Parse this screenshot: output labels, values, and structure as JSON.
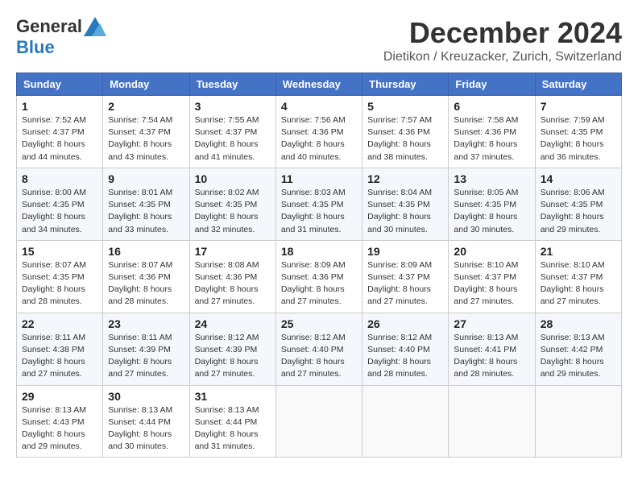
{
  "header": {
    "logo_general": "General",
    "logo_blue": "Blue",
    "month_title": "December 2024",
    "location": "Dietikon / Kreuzacker, Zurich, Switzerland"
  },
  "weekdays": [
    "Sunday",
    "Monday",
    "Tuesday",
    "Wednesday",
    "Thursday",
    "Friday",
    "Saturday"
  ],
  "weeks": [
    [
      {
        "day": "1",
        "sunrise": "7:52 AM",
        "sunset": "4:37 PM",
        "daylight": "8 hours and 44 minutes."
      },
      {
        "day": "2",
        "sunrise": "7:54 AM",
        "sunset": "4:37 PM",
        "daylight": "8 hours and 43 minutes."
      },
      {
        "day": "3",
        "sunrise": "7:55 AM",
        "sunset": "4:37 PM",
        "daylight": "8 hours and 41 minutes."
      },
      {
        "day": "4",
        "sunrise": "7:56 AM",
        "sunset": "4:36 PM",
        "daylight": "8 hours and 40 minutes."
      },
      {
        "day": "5",
        "sunrise": "7:57 AM",
        "sunset": "4:36 PM",
        "daylight": "8 hours and 38 minutes."
      },
      {
        "day": "6",
        "sunrise": "7:58 AM",
        "sunset": "4:36 PM",
        "daylight": "8 hours and 37 minutes."
      },
      {
        "day": "7",
        "sunrise": "7:59 AM",
        "sunset": "4:35 PM",
        "daylight": "8 hours and 36 minutes."
      }
    ],
    [
      {
        "day": "8",
        "sunrise": "8:00 AM",
        "sunset": "4:35 PM",
        "daylight": "8 hours and 34 minutes."
      },
      {
        "day": "9",
        "sunrise": "8:01 AM",
        "sunset": "4:35 PM",
        "daylight": "8 hours and 33 minutes."
      },
      {
        "day": "10",
        "sunrise": "8:02 AM",
        "sunset": "4:35 PM",
        "daylight": "8 hours and 32 minutes."
      },
      {
        "day": "11",
        "sunrise": "8:03 AM",
        "sunset": "4:35 PM",
        "daylight": "8 hours and 31 minutes."
      },
      {
        "day": "12",
        "sunrise": "8:04 AM",
        "sunset": "4:35 PM",
        "daylight": "8 hours and 30 minutes."
      },
      {
        "day": "13",
        "sunrise": "8:05 AM",
        "sunset": "4:35 PM",
        "daylight": "8 hours and 30 minutes."
      },
      {
        "day": "14",
        "sunrise": "8:06 AM",
        "sunset": "4:35 PM",
        "daylight": "8 hours and 29 minutes."
      }
    ],
    [
      {
        "day": "15",
        "sunrise": "8:07 AM",
        "sunset": "4:35 PM",
        "daylight": "8 hours and 28 minutes."
      },
      {
        "day": "16",
        "sunrise": "8:07 AM",
        "sunset": "4:36 PM",
        "daylight": "8 hours and 28 minutes."
      },
      {
        "day": "17",
        "sunrise": "8:08 AM",
        "sunset": "4:36 PM",
        "daylight": "8 hours and 27 minutes."
      },
      {
        "day": "18",
        "sunrise": "8:09 AM",
        "sunset": "4:36 PM",
        "daylight": "8 hours and 27 minutes."
      },
      {
        "day": "19",
        "sunrise": "8:09 AM",
        "sunset": "4:37 PM",
        "daylight": "8 hours and 27 minutes."
      },
      {
        "day": "20",
        "sunrise": "8:10 AM",
        "sunset": "4:37 PM",
        "daylight": "8 hours and 27 minutes."
      },
      {
        "day": "21",
        "sunrise": "8:10 AM",
        "sunset": "4:37 PM",
        "daylight": "8 hours and 27 minutes."
      }
    ],
    [
      {
        "day": "22",
        "sunrise": "8:11 AM",
        "sunset": "4:38 PM",
        "daylight": "8 hours and 27 minutes."
      },
      {
        "day": "23",
        "sunrise": "8:11 AM",
        "sunset": "4:39 PM",
        "daylight": "8 hours and 27 minutes."
      },
      {
        "day": "24",
        "sunrise": "8:12 AM",
        "sunset": "4:39 PM",
        "daylight": "8 hours and 27 minutes."
      },
      {
        "day": "25",
        "sunrise": "8:12 AM",
        "sunset": "4:40 PM",
        "daylight": "8 hours and 27 minutes."
      },
      {
        "day": "26",
        "sunrise": "8:12 AM",
        "sunset": "4:40 PM",
        "daylight": "8 hours and 28 minutes."
      },
      {
        "day": "27",
        "sunrise": "8:13 AM",
        "sunset": "4:41 PM",
        "daylight": "8 hours and 28 minutes."
      },
      {
        "day": "28",
        "sunrise": "8:13 AM",
        "sunset": "4:42 PM",
        "daylight": "8 hours and 29 minutes."
      }
    ],
    [
      {
        "day": "29",
        "sunrise": "8:13 AM",
        "sunset": "4:43 PM",
        "daylight": "8 hours and 29 minutes."
      },
      {
        "day": "30",
        "sunrise": "8:13 AM",
        "sunset": "4:44 PM",
        "daylight": "8 hours and 30 minutes."
      },
      {
        "day": "31",
        "sunrise": "8:13 AM",
        "sunset": "4:44 PM",
        "daylight": "8 hours and 31 minutes."
      },
      null,
      null,
      null,
      null
    ]
  ],
  "labels": {
    "sunrise": "Sunrise:",
    "sunset": "Sunset:",
    "daylight": "Daylight:"
  }
}
